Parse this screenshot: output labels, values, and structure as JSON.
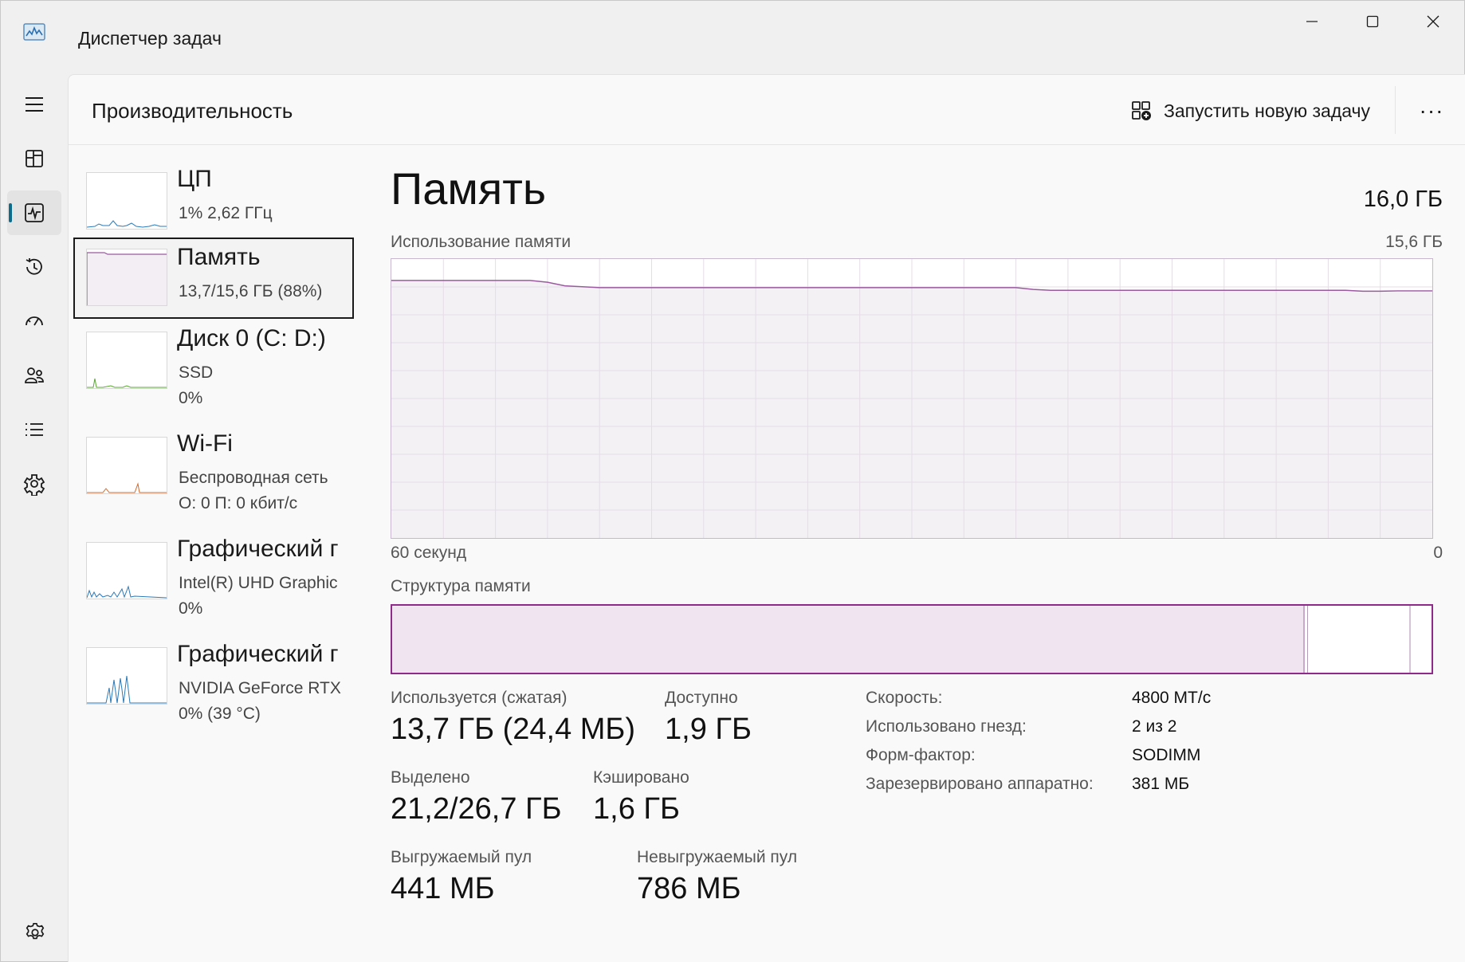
{
  "window": {
    "title": "Диспетчер задач"
  },
  "header": {
    "page_title": "Производительность",
    "run_task_label": "Запустить новую задачу",
    "more_label": "···"
  },
  "nav_rail": {
    "icons": [
      "hamburger-icon",
      "processes-icon",
      "performance-icon",
      "app-history-icon",
      "startup-icon",
      "users-icon",
      "details-icon",
      "services-icon",
      "settings-icon"
    ],
    "active": "performance-icon"
  },
  "devices": [
    {
      "name": "ЦП",
      "line1": "1% 2,62 ГГц",
      "line2": ""
    },
    {
      "name": "Память",
      "line1": "13,7/15,6 ГБ (88%)",
      "line2": ""
    },
    {
      "name": "Диск 0 (C: D:)",
      "line1": "SSD",
      "line2": "0%"
    },
    {
      "name": "Wi-Fi",
      "line1": "Беспроводная сеть",
      "line2": "О: 0 П: 0 кбит/с"
    },
    {
      "name": "Графический г",
      "line1": "Intel(R) UHD Graphic",
      "line2": "0%"
    },
    {
      "name": "Графический г",
      "line1": "NVIDIA GeForce RTX",
      "line2": "0% (39 °C)"
    }
  ],
  "detail": {
    "title": "Память",
    "total": "16,0 ГБ",
    "usage_label": "Использование памяти",
    "usage_max": "15,6 ГБ",
    "axis_left": "60 секунд",
    "axis_right": "0",
    "structure_label": "Структура памяти",
    "structure": {
      "in_use_fraction": 0.878,
      "modified_fraction": 0.881,
      "standby_fraction": 0.98
    },
    "stats": {
      "in_use_label": "Используется (сжатая)",
      "in_use_value": "13,7 ГБ (24,4 МБ)",
      "available_label": "Доступно",
      "available_value": "1,9 ГБ",
      "committed_label": "Выделено",
      "committed_value": "21,2/26,7 ГБ",
      "cached_label": "Кэшировано",
      "cached_value": "1,6 ГБ",
      "paged_label": "Выгружаемый пул",
      "paged_value": "441 МБ",
      "nonpaged_label": "Невыгружаемый пул",
      "nonpaged_value": "786 МБ"
    },
    "info": [
      {
        "label": "Скорость:",
        "value": "4800 МТ/с"
      },
      {
        "label": "Использовано гнезд:",
        "value": "2 из 2"
      },
      {
        "label": "Форм-фактор:",
        "value": "SODIMM"
      },
      {
        "label": "Зарезервировано аппаратно:",
        "value": "381 МБ"
      }
    ]
  },
  "chart_data": {
    "type": "area",
    "title": "Использование памяти",
    "xlabel": "60 секунд",
    "x": [
      60,
      52,
      51,
      50,
      49,
      48,
      47,
      46,
      45,
      44,
      43,
      42,
      41,
      40,
      35,
      30,
      25,
      24,
      23,
      22,
      21,
      20,
      15,
      10,
      5,
      4,
      3,
      2,
      1,
      0
    ],
    "values": [
      14.4,
      14.4,
      14.3,
      14.1,
      14.05,
      14.0,
      14.0,
      14.0,
      14.0,
      14.0,
      14.0,
      14.0,
      14.0,
      14.0,
      14.0,
      14.0,
      14.0,
      14.0,
      13.9,
      13.85,
      13.85,
      13.85,
      13.85,
      13.85,
      13.85,
      13.8,
      13.8,
      13.82,
      13.82,
      13.82
    ],
    "ylim": [
      0,
      15.6
    ],
    "xlim": [
      60,
      0
    ],
    "grid": true,
    "colors": {
      "line": "#9a5aa0",
      "fill": "#f2eef3",
      "grid": "#e4dde6"
    }
  },
  "colors": {
    "accent": "#0f6b8a",
    "memory_line": "#9a5aa0",
    "memory_border": "#8e2a8a",
    "cpu_spark": "#2a7ab8",
    "disk_spark": "#5aa830",
    "wifi_spark": "#d26a2a",
    "gpu_spark": "#2a7ab8"
  }
}
